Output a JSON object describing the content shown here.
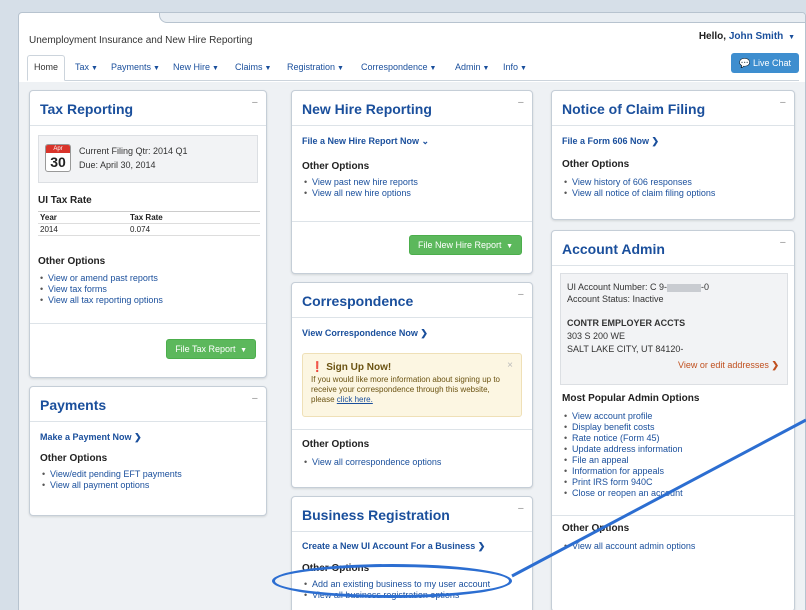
{
  "header": {
    "app_title": "Unemployment Insurance and New Hire Reporting",
    "hello_prefix": "Hello, ",
    "user_name": "John Smith",
    "live_chat": "Live Chat"
  },
  "nav": [
    {
      "label": "Home"
    },
    {
      "label": "Tax"
    },
    {
      "label": "Payments"
    },
    {
      "label": "New Hire"
    },
    {
      "label": "Claims"
    },
    {
      "label": "Registration"
    },
    {
      "label": "Correspondence"
    },
    {
      "label": "Admin"
    },
    {
      "label": "Info"
    }
  ],
  "tax_reporting": {
    "title": "Tax Reporting",
    "cal_month": "Apr",
    "cal_day": "30",
    "filing_qtr": "Current Filing Qtr: 2014 Q1",
    "due": "Due: April 30, 2014",
    "rate_heading": "UI Tax Rate",
    "col_year": "Year",
    "col_rate": "Tax Rate",
    "row_year": "2014",
    "row_rate": "0.074",
    "other_heading": "Other Options",
    "options": [
      "View or amend past reports",
      "View tax forms",
      "View all tax reporting options"
    ],
    "button": "File Tax Report"
  },
  "payments": {
    "title": "Payments",
    "primary_link": "Make a Payment Now",
    "other_heading": "Other Options",
    "options": [
      "View/edit pending EFT payments",
      "View all payment options"
    ]
  },
  "new_hire": {
    "title": "New Hire Reporting",
    "primary_link": "File a New Hire Report Now",
    "other_heading": "Other Options",
    "options": [
      "View past new hire reports",
      "View all new hire options"
    ],
    "button": "File New Hire Report"
  },
  "correspondence": {
    "title": "Correspondence",
    "primary_link": "View Correspondence Now",
    "alert_title": "Sign Up Now!",
    "alert_text": "If you would like more information about signing up to receive your correspondence through this website, please ",
    "alert_link": "click here.",
    "other_heading": "Other Options",
    "options": [
      "View all correspondence options"
    ]
  },
  "business_registration": {
    "title": "Business Registration",
    "primary_link": "Create a New UI Account For a Business",
    "other_heading": "Other Options",
    "options": [
      "Add an existing business to my user account",
      "View all business registration options"
    ]
  },
  "claim_filing": {
    "title": "Notice of Claim Filing",
    "primary_link": "File a Form 606 Now",
    "other_heading": "Other Options",
    "options": [
      "View history of 606 responses",
      "View all notice of claim filing options"
    ]
  },
  "account_admin": {
    "title": "Account Admin",
    "account_number": "UI Account Number: C 9-",
    "account_number_suffix": "-0",
    "account_status": "Account Status: Inactive",
    "company": "CONTR EMPLOYER ACCTS",
    "address1": "303 S 200 WE",
    "address2": "SALT LAKE CITY, UT 84120-",
    "edit_link": "View or edit addresses",
    "popular_heading": "Most Popular Admin Options",
    "popular": [
      "View account profile",
      "Display benefit costs",
      "Rate notice (Form 45)",
      "Update address information",
      "File an appeal",
      "Information for appeals",
      "Print IRS form 940C",
      "Close or reopen an account"
    ],
    "other_heading": "Other Options",
    "options": [
      "View all account admin options"
    ]
  },
  "colors": {
    "link": "#1a4f9c",
    "button_green": "#5cb85c",
    "annotation": "#2c6ed1",
    "accent": "#3e8ecf"
  }
}
